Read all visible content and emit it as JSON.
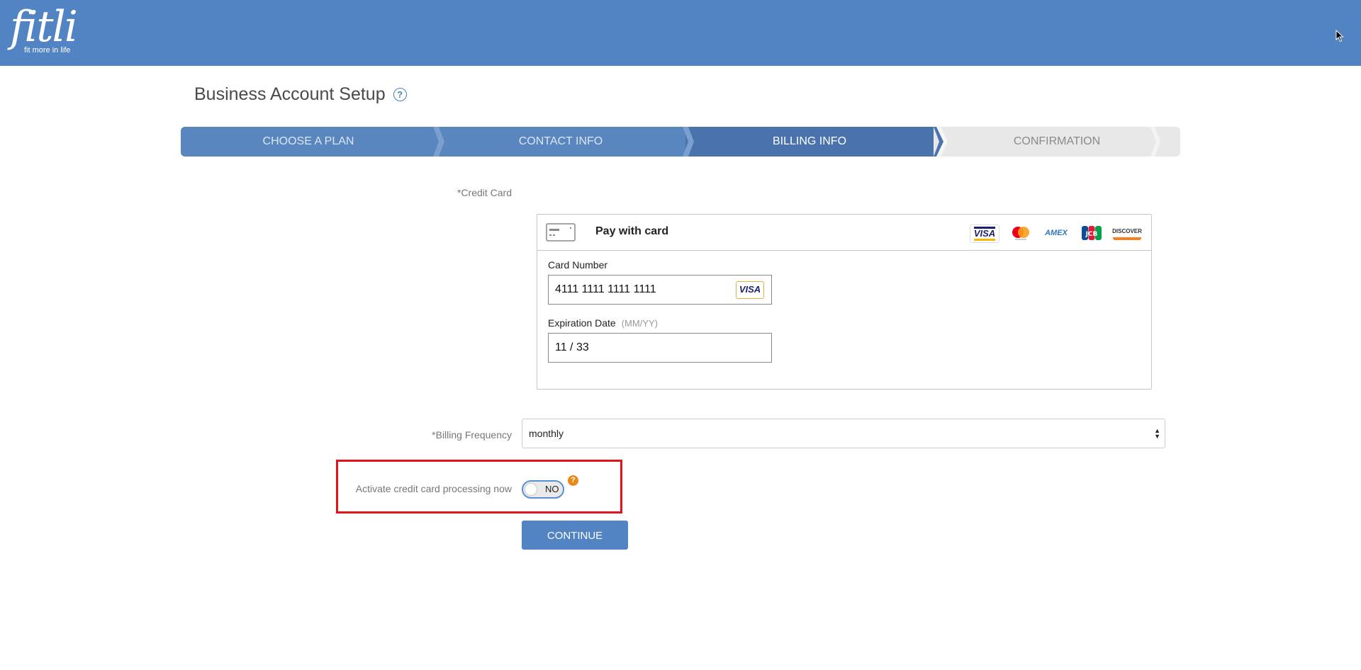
{
  "header": {
    "logo_word": "fitli",
    "logo_tagline": "fit more in life",
    "colors": {
      "bar": "#5283c2"
    }
  },
  "page": {
    "title": "Business Account Setup"
  },
  "steps": [
    {
      "label": "CHOOSE A PLAN",
      "state": "done"
    },
    {
      "label": "CONTACT INFO",
      "state": "done"
    },
    {
      "label": "BILLING INFO",
      "state": "active"
    },
    {
      "label": "CONFIRMATION",
      "state": "todo"
    }
  ],
  "credit_card": {
    "label": "*Credit Card",
    "pay_title": "Pay with card",
    "brands": [
      "VISA",
      "mastercard",
      "AMEX",
      "JCB",
      "DISCOVER"
    ],
    "card_number_label": "Card Number",
    "card_number_value": "4111 1111 1111 1111",
    "card_type_badge": "VISA",
    "expiration_label": "Expiration Date",
    "expiration_hint": "(MM/YY)",
    "expiration_value": "11 / 33"
  },
  "billing": {
    "label": "*Billing Frequency",
    "selected": "monthly"
  },
  "activate": {
    "label": "Activate credit card processing now",
    "toggle_text": "NO",
    "help": "?"
  },
  "actions": {
    "continue_label": "CONTINUE"
  }
}
